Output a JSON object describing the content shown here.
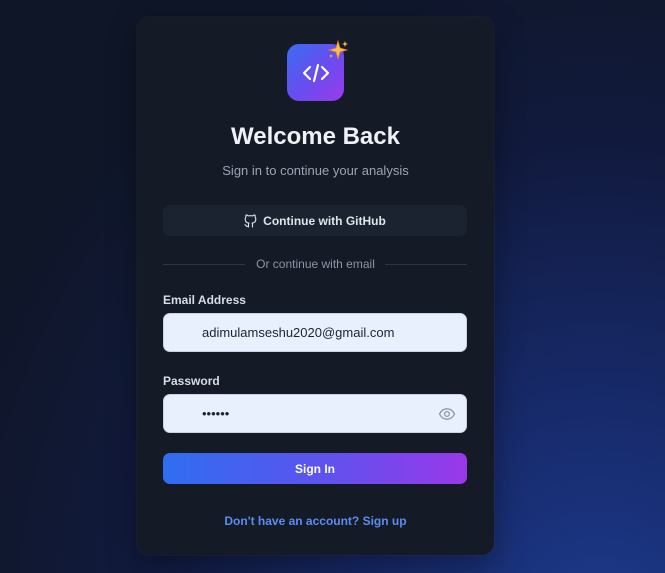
{
  "header": {
    "title": "Welcome Back",
    "subtitle": "Sign in to continue your analysis"
  },
  "icons": {
    "logo": "code-icon",
    "sparkle": "sparkle-icon",
    "github": "github-icon",
    "password_toggle": "eye-icon"
  },
  "github_button": {
    "label": "Continue with GitHub"
  },
  "divider": {
    "label": "Or continue with email"
  },
  "form": {
    "email": {
      "label": "Email Address",
      "value": "adimulamseshu2020@gmail.com"
    },
    "password": {
      "label": "Password",
      "value": "••••••"
    },
    "submit_label": "Sign In"
  },
  "footer": {
    "signup_link": "Don't have an account? Sign up"
  },
  "colors": {
    "accent_start": "#2f6ef0",
    "accent_end": "#9a38ea",
    "link": "#5b8cf0",
    "card_bg": "#141a26"
  }
}
